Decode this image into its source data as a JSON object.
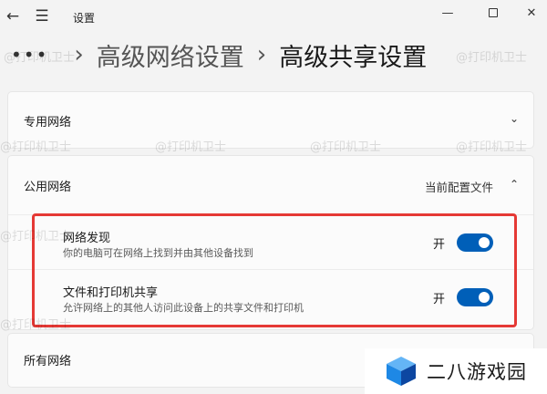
{
  "titlebar": {
    "title": "设置"
  },
  "breadcrumb": {
    "dots": "•••",
    "parent": "高级网络设置",
    "current": "高级共享设置"
  },
  "sections": {
    "private": {
      "label": "专用网络"
    },
    "public": {
      "label": "公用网络",
      "badge": "当前配置文件",
      "settings": [
        {
          "title": "网络发现",
          "description": "你的电脑可在网络上找到并由其他设备找到",
          "state_label": "开",
          "on": true
        },
        {
          "title": "文件和打印机共享",
          "description": "允许网络上的其他人访问此设备上的共享文件和打印机",
          "state_label": "开",
          "on": true
        }
      ]
    },
    "all": {
      "label": "所有网络"
    }
  },
  "watermark": {
    "text": "@打印机卫士"
  },
  "logo": {
    "text": "二八游戏园",
    "colors": [
      "#1e88e5",
      "#0d47a1",
      "#64b5f6"
    ]
  },
  "colors": {
    "toggle_on": "#005fb8",
    "highlight": "#e53935"
  }
}
